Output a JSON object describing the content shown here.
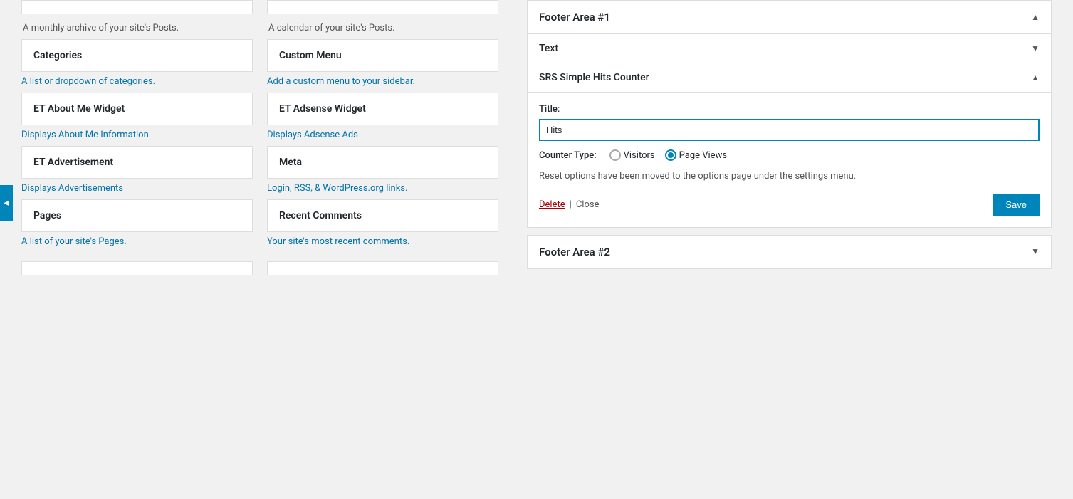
{
  "left": {
    "top_descs": {
      "col1": "A monthly archive of your site's Posts.",
      "col2": "A calendar of your site's Posts."
    },
    "widgets": [
      {
        "id": "categories",
        "title": "Categories",
        "desc": "A list or dropdown of categories."
      },
      {
        "id": "custom-menu",
        "title": "Custom Menu",
        "desc": "Add a custom menu to your sidebar."
      },
      {
        "id": "et-about-me",
        "title": "ET About Me Widget",
        "desc": "Displays About Me Information"
      },
      {
        "id": "et-adsense",
        "title": "ET Adsense Widget",
        "desc": "Displays Adsense Ads"
      },
      {
        "id": "et-advertisement",
        "title": "ET Advertisement",
        "desc": "Displays Advertisements"
      },
      {
        "id": "meta",
        "title": "Meta",
        "desc": "Login, RSS, & WordPress.org links."
      },
      {
        "id": "pages",
        "title": "Pages",
        "desc": "A list of your site's Pages."
      },
      {
        "id": "recent-comments",
        "title": "Recent Comments",
        "desc": "Your site's most recent comments."
      }
    ]
  },
  "right": {
    "footer_area_1": {
      "title": "Footer Area #1",
      "collapsed_widget": {
        "title": "Text"
      },
      "expanded_widget": {
        "section_title": "SRS Simple Hits Counter",
        "title_label": "Title:",
        "title_value": "Hits",
        "counter_type_label": "Counter Type:",
        "option_visitors": "Visitors",
        "option_page_views": "Page Views",
        "reset_note": "Reset options have been moved to the options page under the settings menu.",
        "delete_label": "Delete",
        "sep": "|",
        "close_label": "Close",
        "save_label": "Save"
      }
    },
    "footer_area_2": {
      "title": "Footer Area #2"
    }
  }
}
